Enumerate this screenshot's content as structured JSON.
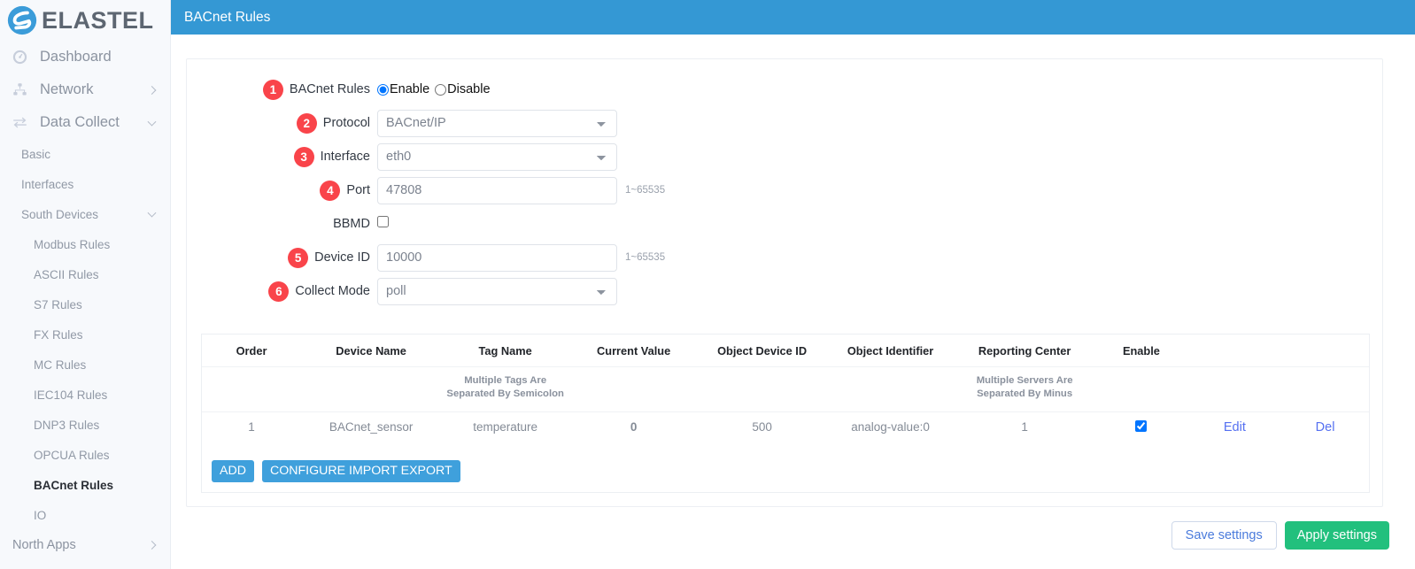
{
  "brand": {
    "name": "ELASTEL",
    "logo_icon": "elastel-logo-icon"
  },
  "topbar": {
    "title": "BACnet Rules"
  },
  "sidebar": {
    "top_items": [
      {
        "label": "Dashboard",
        "icon": "gauge-icon",
        "chevron": "none"
      },
      {
        "label": "Network",
        "icon": "sitemap-icon",
        "chevron": "right"
      },
      {
        "label": "Data Collect",
        "icon": "exchange-icon",
        "chevron": "down"
      }
    ],
    "sub_items": [
      {
        "label": "Basic",
        "level": 1,
        "chevron": "none",
        "active": false
      },
      {
        "label": "Interfaces",
        "level": 1,
        "chevron": "none",
        "active": false
      },
      {
        "label": "South Devices",
        "level": 1,
        "chevron": "down",
        "active": false
      },
      {
        "label": "Modbus Rules",
        "level": 2,
        "chevron": "none",
        "active": false
      },
      {
        "label": "ASCII Rules",
        "level": 2,
        "chevron": "none",
        "active": false
      },
      {
        "label": "S7 Rules",
        "level": 2,
        "chevron": "none",
        "active": false
      },
      {
        "label": "FX Rules",
        "level": 2,
        "chevron": "none",
        "active": false
      },
      {
        "label": "MC Rules",
        "level": 2,
        "chevron": "none",
        "active": false
      },
      {
        "label": "IEC104 Rules",
        "level": 2,
        "chevron": "none",
        "active": false
      },
      {
        "label": "DNP3 Rules",
        "level": 2,
        "chevron": "none",
        "active": false
      },
      {
        "label": "OPCUA Rules",
        "level": 2,
        "chevron": "none",
        "active": false
      },
      {
        "label": "BACnet Rules",
        "level": 2,
        "chevron": "none",
        "active": true
      },
      {
        "label": "IO",
        "level": 2,
        "chevron": "none",
        "active": false
      }
    ],
    "bottom_item": {
      "label": "North Apps",
      "chevron": "right"
    }
  },
  "form": {
    "rows": [
      {
        "badge": "1",
        "label": "BACnet Rules",
        "type": "radio"
      },
      {
        "badge": "2",
        "label": "Protocol",
        "type": "select",
        "value": "BACnet/IP",
        "hint": ""
      },
      {
        "badge": "3",
        "label": "Interface",
        "type": "select",
        "value": "eth0",
        "hint": ""
      },
      {
        "badge": "4",
        "label": "Port",
        "type": "text",
        "value": "47808",
        "hint": "1~65535"
      },
      {
        "badge": "",
        "label": "BBMD",
        "type": "checkbox",
        "checked": false
      },
      {
        "badge": "5",
        "label": "Device ID",
        "type": "text",
        "value": "10000",
        "hint": "1~65535"
      },
      {
        "badge": "6",
        "label": "Collect Mode",
        "type": "select",
        "value": "poll",
        "hint": ""
      }
    ],
    "radio": {
      "enable_label": "Enable",
      "disable_label": "Disable",
      "selected": "Enable"
    },
    "protocol_options": [
      "BACnet/IP"
    ],
    "interface_options": [
      "eth0"
    ],
    "collect_mode_options": [
      "poll"
    ]
  },
  "table": {
    "headers": [
      "Order",
      "Device Name",
      "Tag Name",
      "Current Value",
      "Object Device ID",
      "Object Identifier",
      "Reporting Center",
      "Enable",
      "",
      ""
    ],
    "notes": [
      "",
      "",
      "Multiple Tags Are Separated By Semicolon",
      "",
      "",
      "",
      "Multiple Servers Are Separated By Minus",
      "",
      "",
      ""
    ],
    "rows": [
      {
        "order": "1",
        "device_name": "BACnet_sensor",
        "tag_name": "temperature",
        "current_value": "0",
        "object_device_id": "500",
        "object_identifier": "analog-value:0",
        "reporting_center": "1",
        "enable": true,
        "edit_label": "Edit",
        "del_label": "Del"
      }
    ],
    "buttons": {
      "add": "ADD",
      "configure": "CONFIGURE IMPORT EXPORT"
    }
  },
  "footer": {
    "save": "Save settings",
    "apply": "Apply settings"
  },
  "colors": {
    "header_blue": "#3498d4",
    "badge_red": "#f9444a",
    "button_blue": "#3fa0dc",
    "apply_green": "#22c07d",
    "link_blue": "#5570f1",
    "value_blue": "#1727e0"
  }
}
